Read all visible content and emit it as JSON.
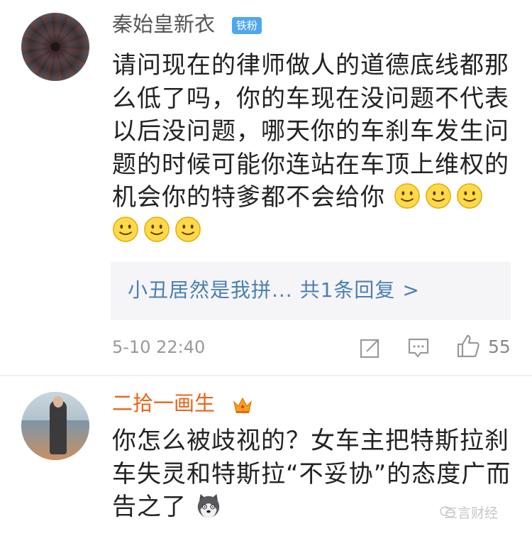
{
  "comments": [
    {
      "user": "秦始皇新衣",
      "badge": "铁粉",
      "text": "请问现在的律师做人的道德底线都那么低了吗，你的车现在没问题不代表以后没问题，哪天你的车刹车发生问题的时候可能你连站在车顶上维权的机会你的特爹都不会给你",
      "smileys": 6,
      "reply_preview": "小丑居然是我拼...  共1条回复 >",
      "time": "5-10 22:40",
      "likes": "55"
    },
    {
      "user": "二拾一画生",
      "text": "你怎么被歧视的？女车主把特斯拉刹车失灵和特斯拉“不妥协”的态度广而告之了"
    }
  ],
  "watermark": "三言财经",
  "icons": [
    "share-icon",
    "comment-icon",
    "like-icon",
    "crown-icon",
    "smiley-emoji-icon",
    "husky-emoji-icon"
  ],
  "colors": {
    "accent_orange": "#e8651a",
    "badge_blue": "#4fa7f0",
    "link_blue": "#4a7fb5"
  }
}
